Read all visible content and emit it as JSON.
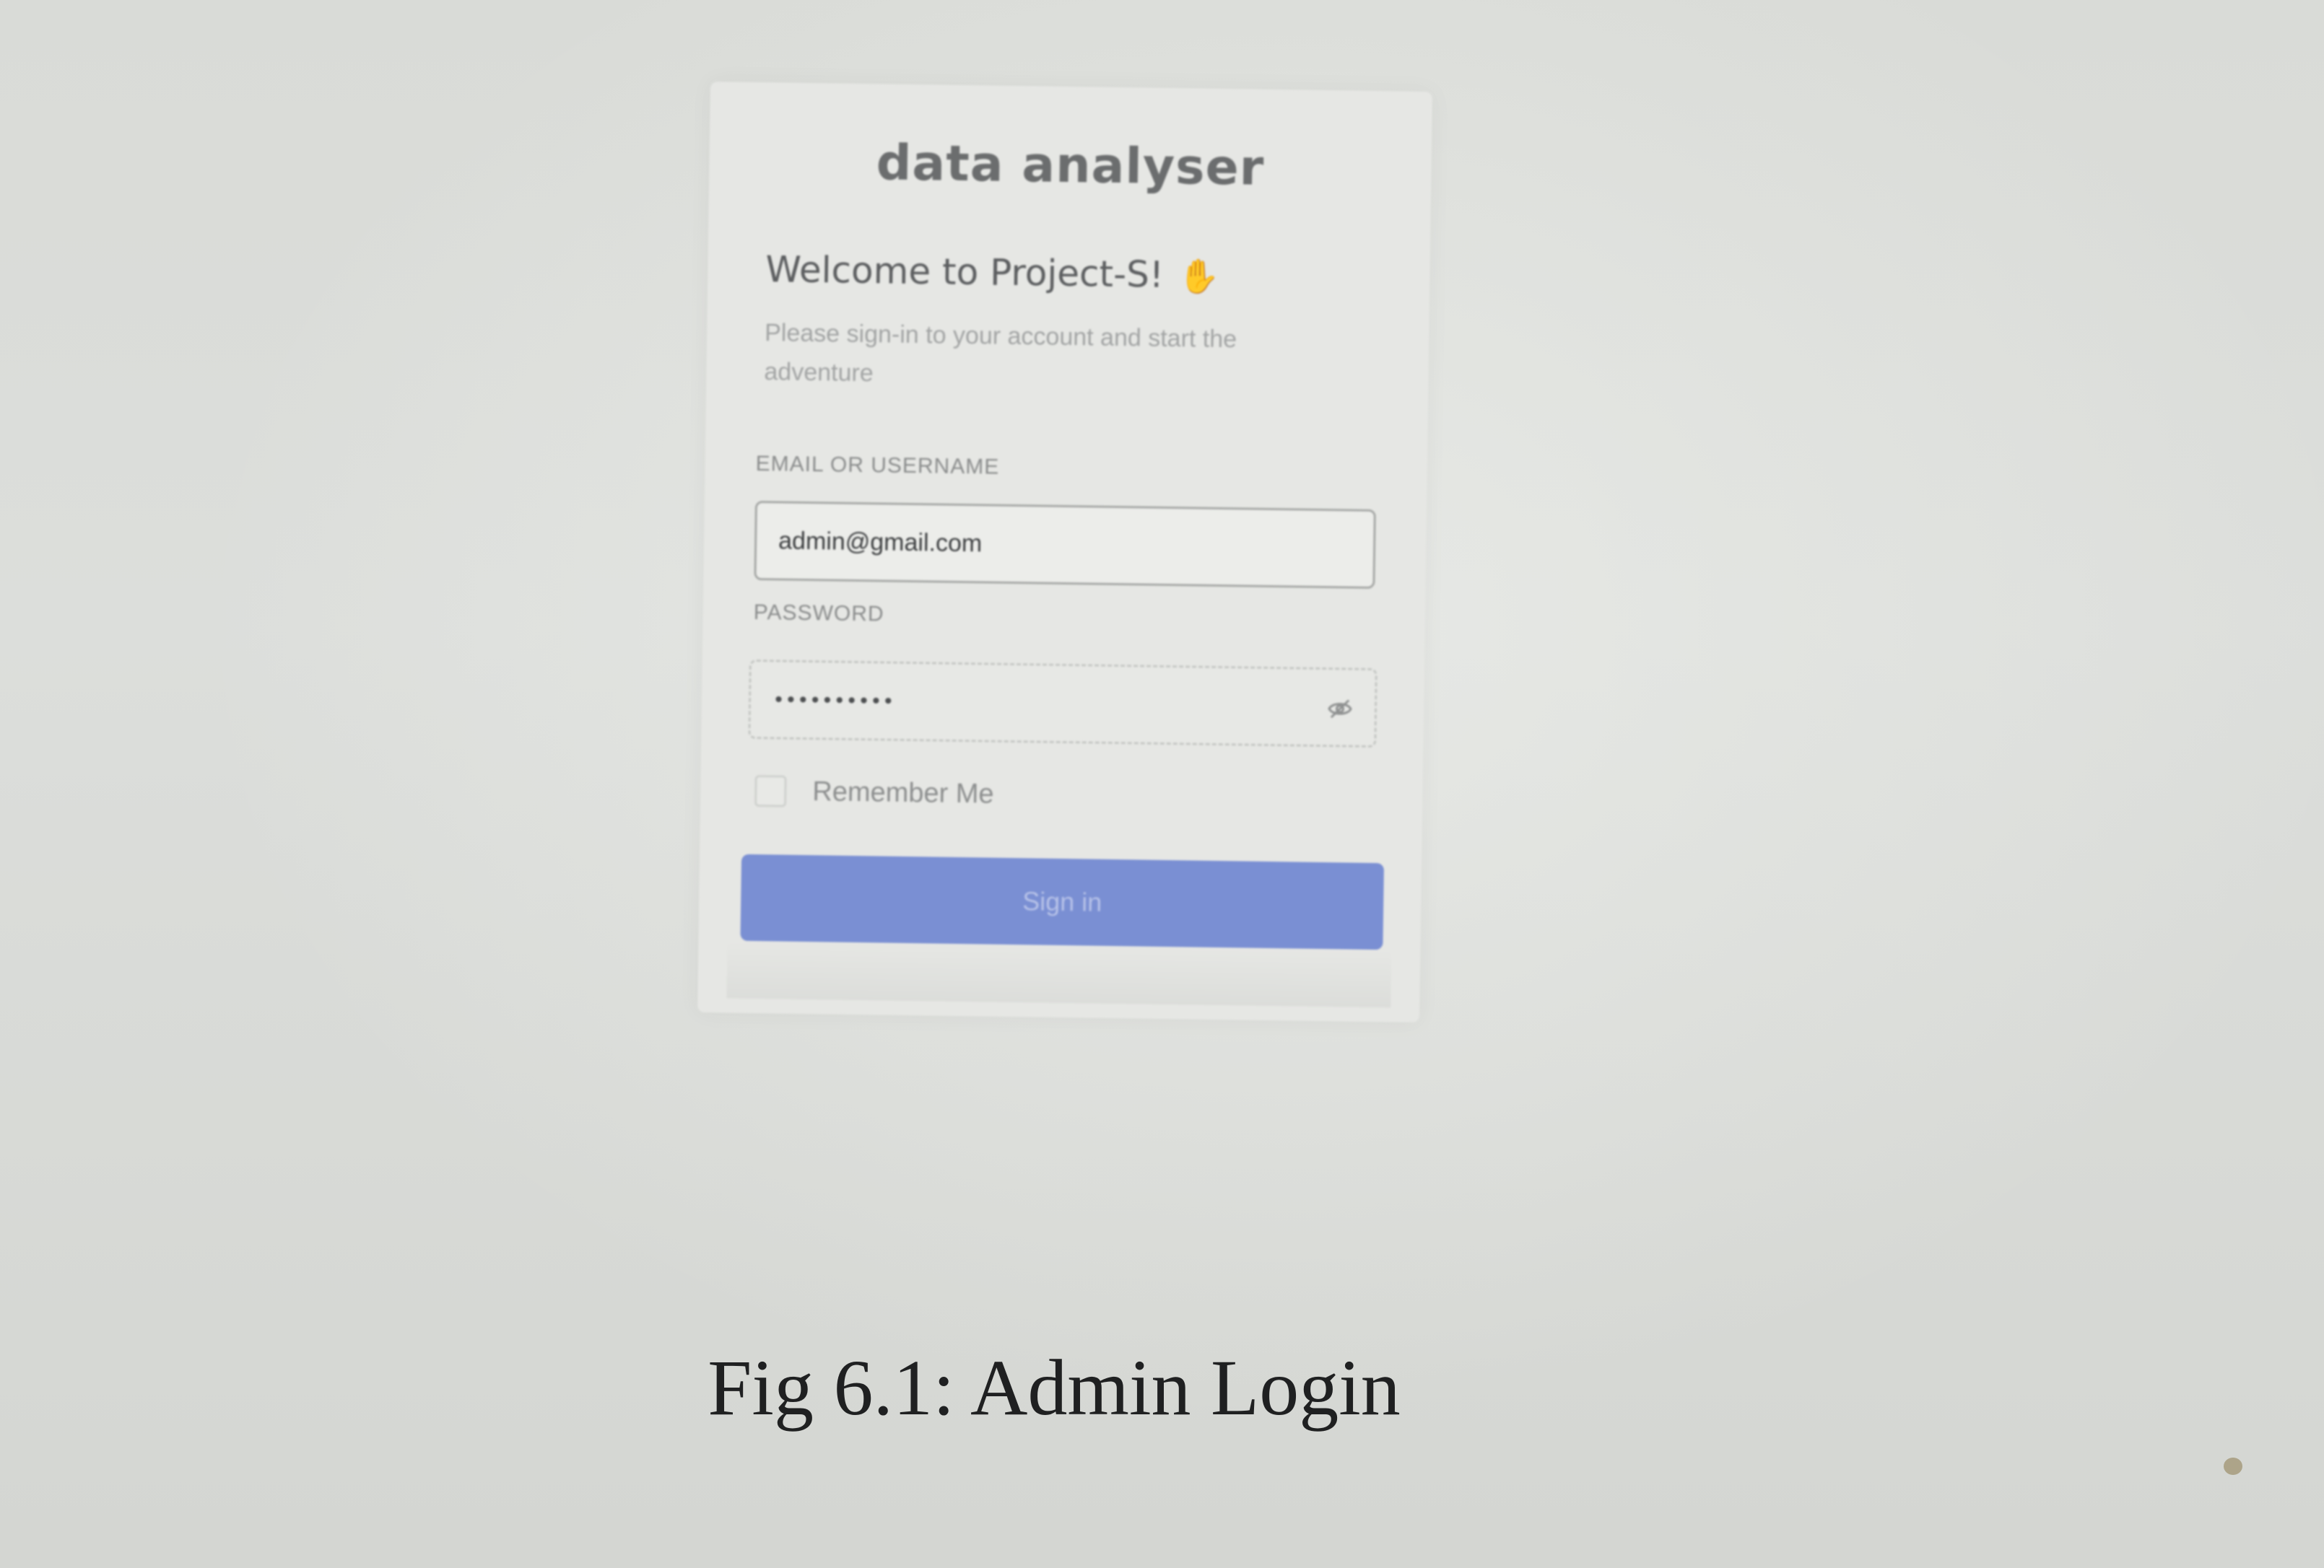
{
  "login": {
    "brand": "data analyser",
    "welcome_title": "Welcome to Project-S!",
    "welcome_icon": "waving-hand-icon",
    "subtitle": "Please sign-in to your account and start the adventure",
    "email_label": "EMAIL OR USERNAME",
    "email_value": "admin@gmail.com",
    "password_label": "PASSWORD",
    "password_value": "••••••••••",
    "password_toggle_icon": "eye-off-icon",
    "remember_label": "Remember Me",
    "remember_checked": false,
    "signin_label": "Sign in",
    "accent_color": "#7a8fd3"
  },
  "caption": {
    "text": "Fig 6.1: Admin Login"
  }
}
